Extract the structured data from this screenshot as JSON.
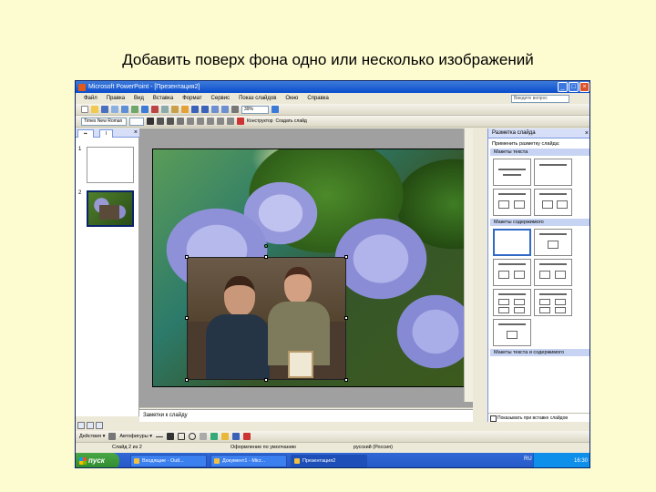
{
  "page": {
    "title": "Добавить поверх фона одно или несколько изображений"
  },
  "window": {
    "title": "Microsoft PowerPoint - [Презентация2]",
    "menu": [
      "Файл",
      "Правка",
      "Вид",
      "Вставка",
      "Формат",
      "Сервис",
      "Показ слайдов",
      "Окно",
      "Справка"
    ],
    "help_placeholder": "Введите вопрос",
    "zoom": "39%",
    "toolbar2": {
      "font": "Times New Roman",
      "design_label": "Конструктор",
      "new_slide_label": "Создать слайд"
    }
  },
  "outline_pane": {
    "tabs": [
      "▪▪",
      "I"
    ],
    "slide_numbers": [
      "1",
      "2"
    ]
  },
  "notes": {
    "placeholder": "Заметки к слайду"
  },
  "task_pane": {
    "title": "Разметка слайда",
    "apply_label": "Применить разметку слайда:",
    "sections": [
      "Макеты текста",
      "Макеты содержимого",
      "Макеты текста и содержимого"
    ],
    "footer": "Показывать при вставке слайдов"
  },
  "draw_bar": {
    "actions_label": "Действия ▾",
    "autoshapes_label": "Автофигуры ▾"
  },
  "status_bar": {
    "slide": "Слайд 2 из 2",
    "design": "Оформление по умолчанию",
    "language": "русский (Россия)"
  },
  "taskbar": {
    "start": "пуск",
    "items": [
      "Входящие - Outl...",
      "Документ1 - Micr...",
      "Презентация2"
    ],
    "lang": "RU",
    "clock": "16:30"
  },
  "colors": {
    "title_bar": "#0a4ccd",
    "page_bg": "#fdfcd0",
    "taskbar": "#2457c6"
  }
}
